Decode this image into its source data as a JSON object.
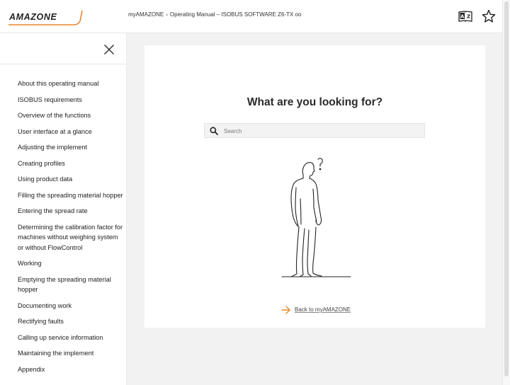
{
  "header": {
    "logo_text": "AMAZONE",
    "breadcrumb": [
      {
        "label": "myAMAZONE"
      },
      {
        "label": "Operating Manual – ISOBUS SOFTWARE Z6-TX oo"
      }
    ],
    "breadcrumb_separator": "›",
    "icons": [
      "translate-icon",
      "star-icon"
    ]
  },
  "sidebar": {
    "items": [
      {
        "label": "About this operating manual"
      },
      {
        "label": "ISOBUS requirements"
      },
      {
        "label": "Overview of the functions"
      },
      {
        "label": "User interface at a glance"
      },
      {
        "label": "Adjusting the implement"
      },
      {
        "label": "Creating profiles"
      },
      {
        "label": "Using product data"
      },
      {
        "label": "Filling the spreading material hopper"
      },
      {
        "label": "Entering the spread rate"
      },
      {
        "label": "Determining the calibration factor for machines without weighing system or without FlowControl"
      },
      {
        "label": "Working"
      },
      {
        "label": "Emptying the spreading material hopper"
      },
      {
        "label": "Documenting work"
      },
      {
        "label": "Rectifying faults"
      },
      {
        "label": "Calling up service information"
      },
      {
        "label": "Maintaining the implement"
      },
      {
        "label": "Appendix"
      }
    ]
  },
  "main": {
    "title": "What are you looking for?",
    "search_placeholder": "Search",
    "back_link": "Back to myAMAZONE"
  },
  "colors": {
    "accent": "#e8862a",
    "text": "#222222",
    "background": "#f2f2f2"
  }
}
